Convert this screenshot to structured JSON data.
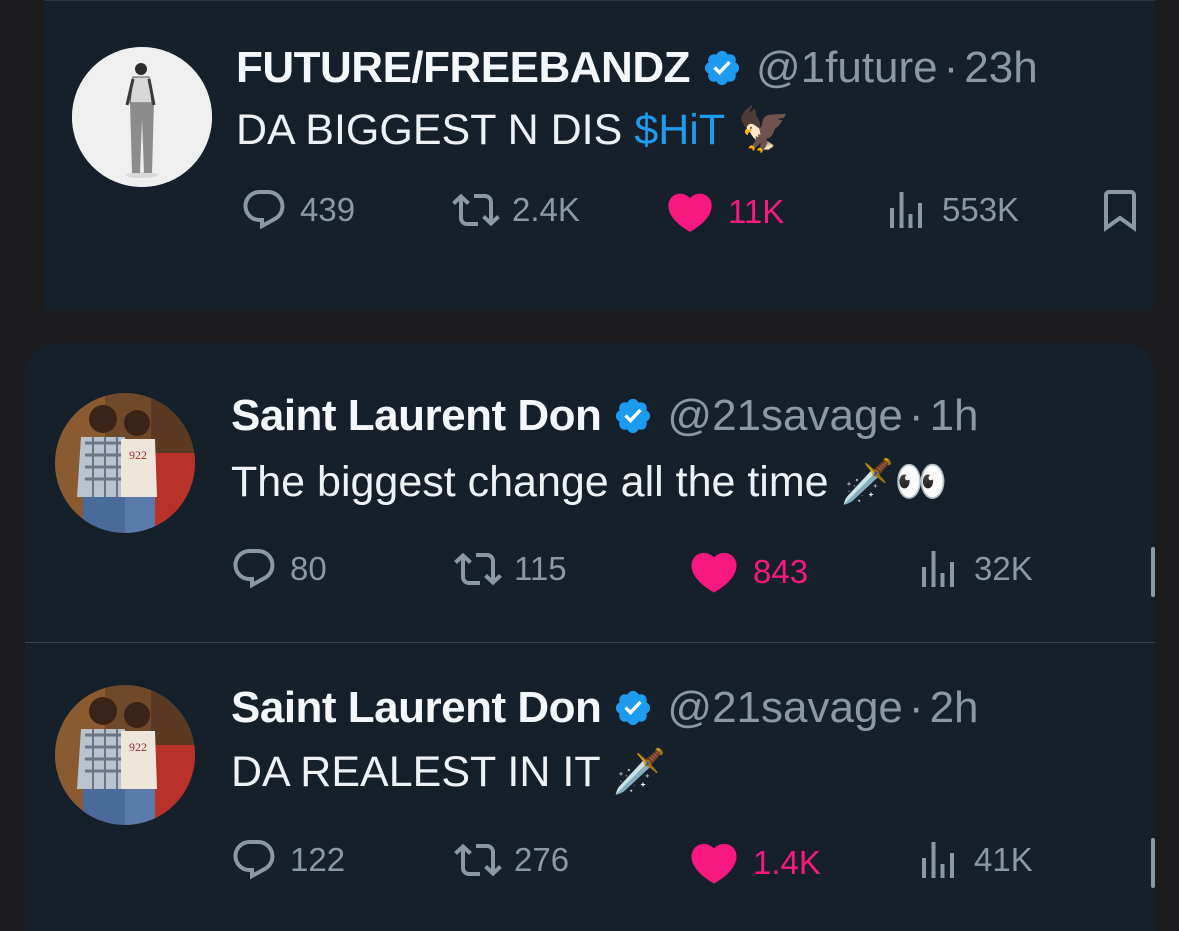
{
  "colors": {
    "background": "#1c1c1e",
    "card": "#15202b",
    "text": "#e7e9ea",
    "muted": "#8b98a5",
    "link": "#1d9bf0",
    "like": "#f91880",
    "verified": "#1d9bf0"
  },
  "tweets": [
    {
      "name": "FUTURE/FREEBANDZ",
      "handle": "@1future",
      "separator": "·",
      "time": "23h",
      "text": "DA BIGGEST N DIS",
      "link_text": "$HiT",
      "emoji": "🦅",
      "emoji_icon": "eagle-icon",
      "replies": "439",
      "reposts": "2.4K",
      "likes": "11K",
      "views": "553K"
    },
    {
      "name": "Saint Laurent Don",
      "handle": "@21savage",
      "separator": "·",
      "time": "1h",
      "text": "The biggest change all the time",
      "emoji": "🗡️👀",
      "emoji_icon": "dagger-eyes-icon",
      "replies": "80",
      "reposts": "115",
      "likes": "843",
      "views": "32K"
    },
    {
      "name": "Saint Laurent Don",
      "handle": "@21savage",
      "separator": "·",
      "time": "2h",
      "text": "DA REALEST IN IT",
      "emoji": "🗡️",
      "emoji_icon": "dagger-icon",
      "replies": "122",
      "reposts": "276",
      "likes": "1.4K",
      "views": "41K"
    }
  ],
  "icons": {
    "reply": "reply-icon",
    "repost": "repost-icon",
    "like": "heart-icon",
    "views": "views-icon",
    "bookmark": "bookmark-icon",
    "verified": "verified-badge-icon"
  }
}
